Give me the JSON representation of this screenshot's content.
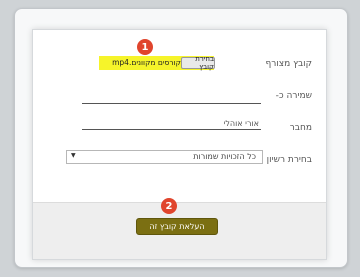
{
  "form": {
    "file_label": "קובץ מצורף",
    "choose_file_label": "בחירת קובץ",
    "file_name": "קורסים מקוונים.mp4",
    "save_as_label": "שמירה כ-",
    "save_as_value": "",
    "author_label": "מחבר",
    "author_value": "אורי אוהלי",
    "license_label": "בחירת רשיון",
    "license_value": "כל הזכויות שמורות",
    "upload_label": "העלאת קובץ זה"
  },
  "annotations": {
    "step1": "1",
    "step2": "2"
  },
  "colors": {
    "highlight": "#f6f42a",
    "badge": "#e0452d",
    "upload_button": "#7b6f12"
  }
}
